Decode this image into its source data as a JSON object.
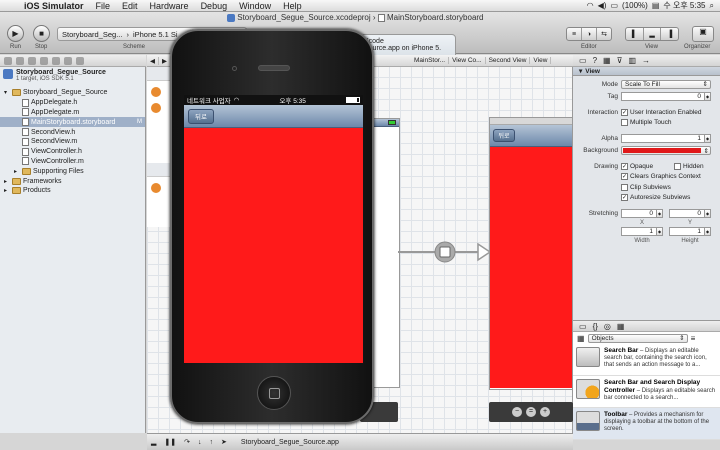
{
  "menubar": {
    "app": "iOS Simulator",
    "items": [
      "File",
      "Edit",
      "Hardware",
      "Debug",
      "Window",
      "Help"
    ],
    "battery": "(100%)",
    "clock": "수 오후 5:35"
  },
  "window": {
    "title_project": "Storyboard_Segue_Source.xcodeproj",
    "title_file": "MainStoryboard.storyboard"
  },
  "toolbar": {
    "run_label": "Run",
    "stop_label": "Stop",
    "scheme_label": "Scheme",
    "scheme_target": "Storyboard_Seg...",
    "scheme_device": "iPhone 5.1 Si",
    "activity_line1": "Xcode",
    "activity_line2": "Source.app on iPhone 5.",
    "editor_label": "Editor",
    "view_label": "View",
    "organizer_label": "Organizer"
  },
  "navigator": {
    "project_name": "Storyboard_Segue_Source",
    "project_sub": "1 target, iOS SDK 5.1",
    "items": [
      {
        "label": "Storyboard_Segue_Source",
        "kind": "folder",
        "level": 1,
        "open": true
      },
      {
        "label": "AppDelegate.h",
        "kind": "file",
        "level": 2
      },
      {
        "label": "AppDelegate.m",
        "kind": "file",
        "level": 2
      },
      {
        "label": "MainStoryboard.storyboard",
        "kind": "file",
        "level": 2,
        "selected": true,
        "badge": "M"
      },
      {
        "label": "SecondView.h",
        "kind": "file",
        "level": 2
      },
      {
        "label": "SecondView.m",
        "kind": "file",
        "level": 2
      },
      {
        "label": "ViewController.h",
        "kind": "file",
        "level": 2
      },
      {
        "label": "ViewController.m",
        "kind": "file",
        "level": 2
      },
      {
        "label": "Supporting Files",
        "kind": "folder",
        "level": 2
      },
      {
        "label": "Frameworks",
        "kind": "folder",
        "level": 1
      },
      {
        "label": "Products",
        "kind": "folder",
        "level": 1
      }
    ]
  },
  "jumpbar": {
    "crumbs": [
      "MainStor...",
      "View Co...",
      "Second View",
      "View"
    ]
  },
  "simulator": {
    "carrier": "네트워크 사업자",
    "time": "오후 5:35",
    "back_button": "뒤로",
    "content_color": "#ff1a1a"
  },
  "scenes": {
    "second_back_button": "뒤로"
  },
  "bottombar": {
    "target": "Storyboard_Segue_Source.app"
  },
  "inspector": {
    "section": "View",
    "mode_label": "Mode",
    "mode_value": "Scale To Fill",
    "tag_label": "Tag",
    "tag_value": "0",
    "interaction_label": "Interaction",
    "user_interaction": "User Interaction Enabled",
    "multiple_touch": "Multiple Touch",
    "alpha_label": "Alpha",
    "alpha_value": "1",
    "background_label": "Background",
    "background_color": "#e0181a",
    "drawing_label": "Drawing",
    "opaque": "Opaque",
    "hidden": "Hidden",
    "clears": "Clears Graphics Context",
    "clip": "Clip Subviews",
    "autoresize": "Autoresize Subviews",
    "stretching_label": "Stretching",
    "stretch_x": "0",
    "stretch_y": "0",
    "x_label": "X",
    "y_label": "Y",
    "stretch_w": "1",
    "stretch_h": "1",
    "width_label": "Width",
    "height_label": "Height"
  },
  "library": {
    "selector": "Objects",
    "items": [
      {
        "title": "Search Bar",
        "desc": " – Displays an editable search bar, containing the search icon, that sends an action message to a..."
      },
      {
        "title": "Search Bar and Search Display Controller",
        "desc": " – Displays an editable search bar connected to a search..."
      },
      {
        "title": "Toolbar",
        "desc": " – Provides a mechanism for displaying a toolbar at the bottom of the screen."
      }
    ]
  }
}
